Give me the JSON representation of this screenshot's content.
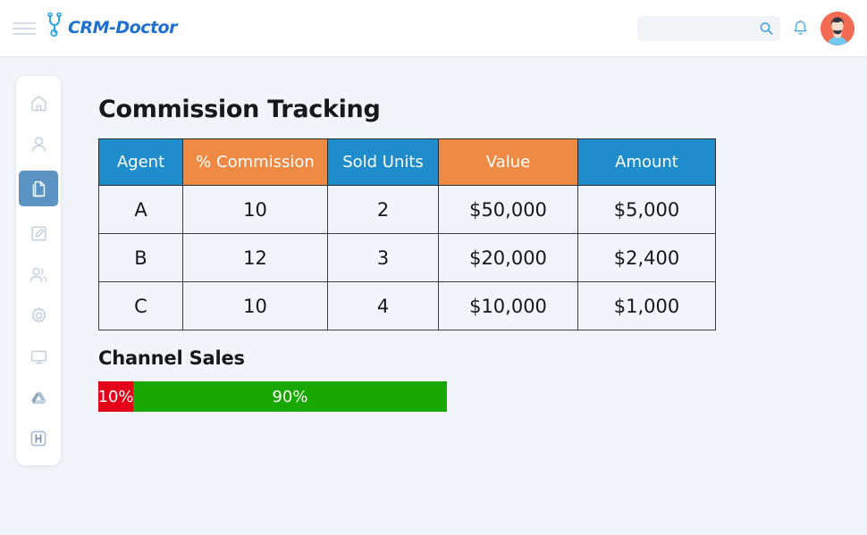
{
  "topbar": {
    "menu_icon": "hamburger-icon",
    "brand_name": "CRM-Doctor",
    "brand_mark_icon": "stethoscope-icon",
    "search": {
      "value": "",
      "placeholder": "",
      "icon": "search-icon"
    },
    "notifications_icon": "bell-icon",
    "avatar_icon": "user-avatar"
  },
  "sidebar": {
    "items": [
      {
        "name": "home",
        "icon": "home-icon",
        "active": false
      },
      {
        "name": "contacts",
        "icon": "person-icon",
        "active": false
      },
      {
        "name": "documents",
        "icon": "documents-icon",
        "active": true
      },
      {
        "name": "notes",
        "icon": "edit-square-icon",
        "active": false
      },
      {
        "name": "teams",
        "icon": "users-group-icon",
        "active": false
      },
      {
        "name": "settings",
        "icon": "gear-icon",
        "active": false
      },
      {
        "name": "desktop",
        "icon": "monitor-icon",
        "active": false
      },
      {
        "name": "drive",
        "icon": "drive-icon",
        "active": false
      },
      {
        "name": "hospital",
        "icon": "h-badge-icon",
        "active": false
      }
    ]
  },
  "main": {
    "page_title": "Commission Tracking",
    "table": {
      "headers": [
        {
          "label": "Agent",
          "color": "#1f8ccc"
        },
        {
          "label": "% Commission",
          "color": "#ee8a44"
        },
        {
          "label": "Sold Units",
          "color": "#1f8ccc"
        },
        {
          "label": "Value",
          "color": "#ee8a44"
        },
        {
          "label": "Amount",
          "color": "#1f8ccc"
        }
      ],
      "rows": [
        [
          "A",
          "10",
          "2",
          "$50,000",
          "$5,000"
        ],
        [
          "B",
          "12",
          "3",
          "$20,000",
          "$2,400"
        ],
        [
          "C",
          "10",
          "4",
          "$10,000",
          "$1,000"
        ]
      ]
    },
    "channel_sales": {
      "title": "Channel Sales",
      "segments": [
        {
          "label": "10%",
          "value": 10,
          "color": "#e50019"
        },
        {
          "label": "90%",
          "value": 90,
          "color": "#19a800"
        }
      ]
    }
  },
  "chart_data": {
    "type": "bar",
    "title": "Channel Sales",
    "orientation": "horizontal-stacked",
    "categories": [
      "Channel Sales"
    ],
    "series": [
      {
        "name": "10%",
        "values": [
          10
        ],
        "color": "#e50019"
      },
      {
        "name": "90%",
        "values": [
          90
        ],
        "color": "#19a800"
      }
    ],
    "xlabel": "",
    "ylabel": "",
    "xlim": [
      0,
      100
    ],
    "grid": false,
    "legend": "none",
    "data_labels": [
      "10%",
      "90%"
    ]
  },
  "colors": {
    "page_background": "#f1f4f9",
    "header_blue": "#1f8ccc",
    "header_orange": "#ee8a44",
    "sidebar_active": "#5b93c4",
    "brand_blue": "#1f6fd0",
    "bar_red": "#e50019",
    "bar_green": "#19a800"
  }
}
